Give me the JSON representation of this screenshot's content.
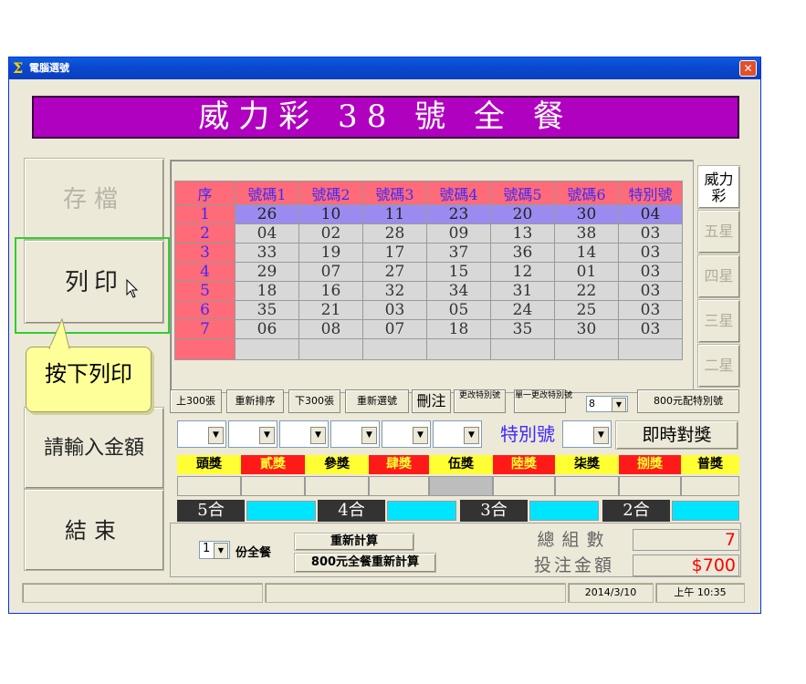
{
  "window": {
    "title": "電腦選號"
  },
  "banner": "威力彩 38 號 全 餐",
  "left_buttons": {
    "save": "存檔",
    "print": "列印",
    "amount": "請輸入金額",
    "exit": "結束"
  },
  "callout": "按下列印",
  "grid": {
    "headers": [
      "序",
      "號碼1",
      "號碼2",
      "號碼3",
      "號碼4",
      "號碼5",
      "號碼6",
      "特別號"
    ],
    "rows": [
      [
        "1",
        "26",
        "10",
        "11",
        "23",
        "20",
        "30",
        "04"
      ],
      [
        "2",
        "04",
        "02",
        "28",
        "09",
        "13",
        "38",
        "03"
      ],
      [
        "3",
        "33",
        "19",
        "17",
        "37",
        "36",
        "14",
        "03"
      ],
      [
        "4",
        "29",
        "07",
        "27",
        "15",
        "12",
        "01",
        "03"
      ],
      [
        "5",
        "18",
        "16",
        "32",
        "34",
        "31",
        "22",
        "03"
      ],
      [
        "6",
        "35",
        "21",
        "03",
        "05",
        "24",
        "25",
        "03"
      ],
      [
        "7",
        "06",
        "08",
        "07",
        "18",
        "35",
        "30",
        "03"
      ]
    ]
  },
  "side_tabs": [
    "威力彩",
    "五星",
    "四星",
    "三星",
    "二星"
  ],
  "toolbar": {
    "prev300": "上300張",
    "resort": "重新排序",
    "next300": "下300張",
    "reselect": "重新選號",
    "delete": "刪注",
    "change_special": "更改特別號",
    "single_change_special": "單一更改特別號",
    "special_select_value": "8",
    "special_800": "800元配特別號"
  },
  "special_label": "特別號",
  "compare_button": "即時對獎",
  "prizes": [
    {
      "label": "頭獎",
      "bg": "#ffff33",
      "fg": "#000000"
    },
    {
      "label": "貳獎",
      "bg": "#ff1a1a",
      "fg": "#ffff33"
    },
    {
      "label": "參獎",
      "bg": "#ffff33",
      "fg": "#000000"
    },
    {
      "label": "肆獎",
      "bg": "#ff1a1a",
      "fg": "#ffff33"
    },
    {
      "label": "伍獎",
      "bg": "#ffff33",
      "fg": "#000000"
    },
    {
      "label": "陸獎",
      "bg": "#ff1a1a",
      "fg": "#ffff33"
    },
    {
      "label": "柒獎",
      "bg": "#ffff33",
      "fg": "#000000"
    },
    {
      "label": "捌獎",
      "bg": "#ff1a1a",
      "fg": "#ffff33"
    },
    {
      "label": "普獎",
      "bg": "#ffff33",
      "fg": "#000000"
    }
  ],
  "hits": [
    "5合",
    "4合",
    "3合",
    "2合"
  ],
  "bottom": {
    "copies_value": "1",
    "copies_label": "份全餐",
    "recalc": "重新計算",
    "recalc800": "800元全餐重新計算",
    "total_label": "總組數",
    "total_value": "7",
    "amount_label": "投注金額",
    "amount_value": "$700"
  },
  "status": {
    "date": "2014/3/10",
    "time": "上午 10:35"
  },
  "colors": {
    "banner": "#b000c0",
    "header": "#ff6b78",
    "selected_row": "#9b8bf0",
    "hit_box": "#00e5ff"
  }
}
